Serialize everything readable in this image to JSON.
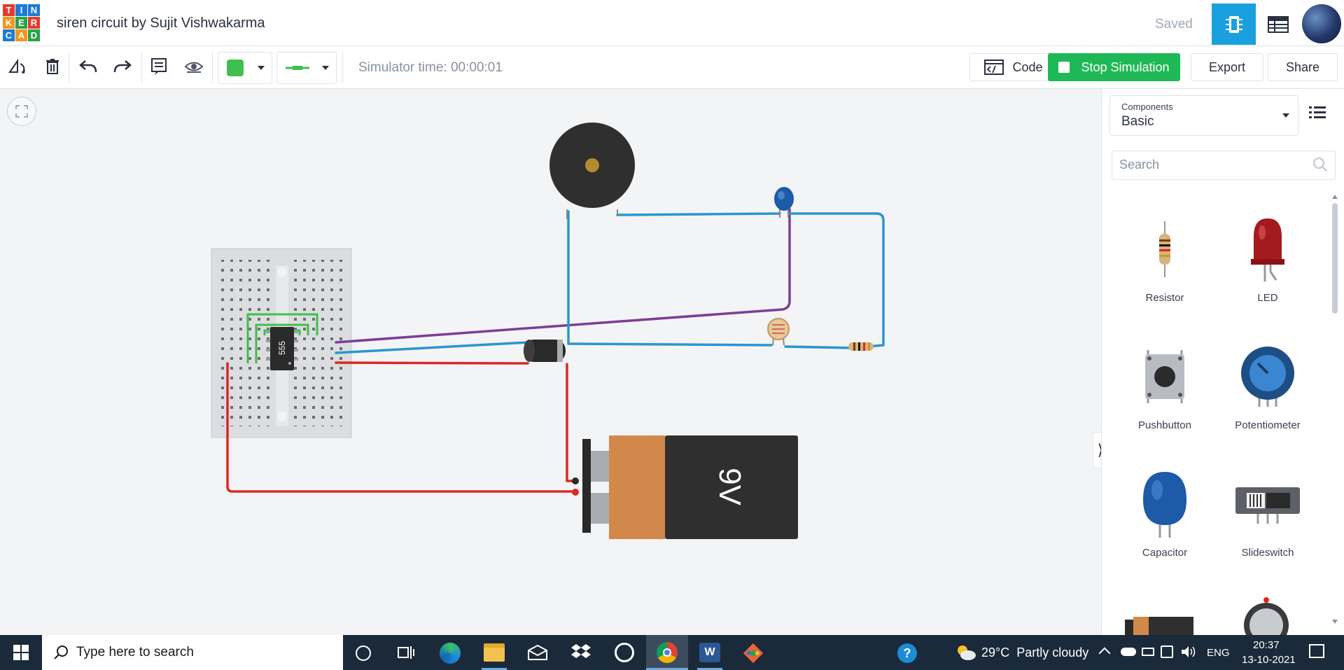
{
  "app": {
    "logo_letters": [
      "T",
      "I",
      "N",
      "K",
      "E",
      "R",
      "C",
      "A",
      "D"
    ],
    "logo_colors": [
      "#e63a2e",
      "#1c7cd6",
      "#1c7cd6",
      "#f7941d",
      "#2aa24a",
      "#e63a2e",
      "#1c7cd6",
      "#f7941d",
      "#2aa24a"
    ],
    "title": "siren circuit by Sujit Vishwakarma",
    "save_status": "Saved",
    "accent": "#1aa0de"
  },
  "toolbar": {
    "sim_time": "Simulator time: 00:00:01",
    "code_label": "Code",
    "stop_label": "Stop Simulation",
    "export_label": "Export",
    "share_label": "Share",
    "wire_color": "#3fbf4f"
  },
  "canvas": {
    "ic_label": "555",
    "battery_label": "9V"
  },
  "panel": {
    "components_label": "Components",
    "components_value": "Basic",
    "search_placeholder": "Search",
    "items": [
      {
        "name": "Resistor"
      },
      {
        "name": "LED"
      },
      {
        "name": "Pushbutton"
      },
      {
        "name": "Potentiometer"
      },
      {
        "name": "Capacitor"
      },
      {
        "name": "Slideswitch"
      }
    ]
  },
  "taskbar": {
    "search_placeholder": "Type here to search",
    "weather": "29°C  Partly cloudy",
    "lang": "ENG",
    "time": "20:37",
    "date": "13-10-2021"
  }
}
